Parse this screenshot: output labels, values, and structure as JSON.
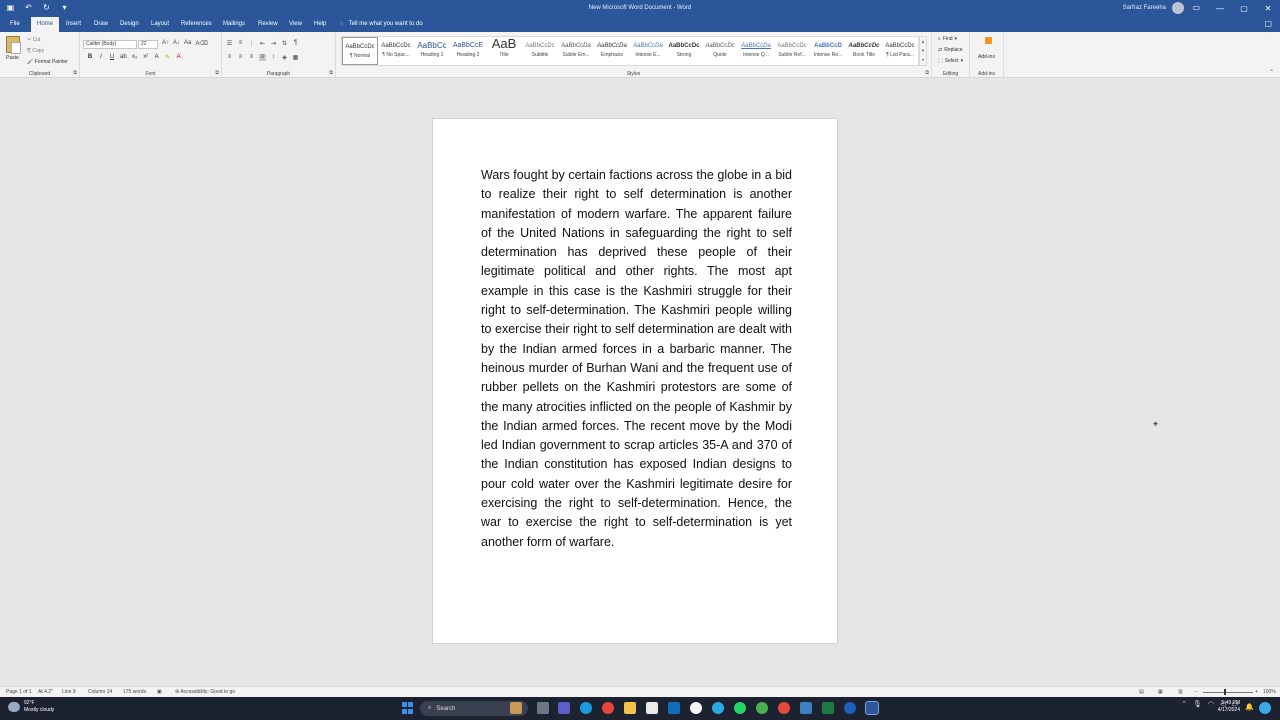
{
  "window": {
    "doc_title": "New Microsoft Word Document  -  Word",
    "user_name": "Sarfraz Fareeha"
  },
  "tabs": [
    "File",
    "Home",
    "Insert",
    "Draw",
    "Design",
    "Layout",
    "References",
    "Mailings",
    "Review",
    "View",
    "Help"
  ],
  "tell_me": "Tell me what you want to do",
  "ribbon": {
    "clipboard": {
      "paste": "Paste",
      "cut": "Cut",
      "copy": "Copy",
      "format_painter": "Format Painter",
      "label": "Clipboard"
    },
    "font": {
      "name": "Calibri (Body)",
      "size": "22",
      "label": "Font"
    },
    "paragraph": {
      "label": "Paragraph"
    },
    "styles": {
      "label": "Styles",
      "items": [
        {
          "sample": "AaBbCcDc",
          "name": "¶ Normal"
        },
        {
          "sample": "AaBbCcDc",
          "name": "¶ No Spac..."
        },
        {
          "sample": "AaBbCc",
          "name": "Heading 1"
        },
        {
          "sample": "AaBbCcE",
          "name": "Heading 2"
        },
        {
          "sample": "AaB",
          "name": "Title"
        },
        {
          "sample": "AaBbCcDc",
          "name": "Subtitle"
        },
        {
          "sample": "AaBbCcDa",
          "name": "Subtle Em..."
        },
        {
          "sample": "AaBbCcDa",
          "name": "Emphasis"
        },
        {
          "sample": "AaBbCcDa",
          "name": "Intense E..."
        },
        {
          "sample": "AaBbCcDc",
          "name": "Strong"
        },
        {
          "sample": "AaBbCcDc",
          "name": "Quote"
        },
        {
          "sample": "AaBbCcDa",
          "name": "Intense Q..."
        },
        {
          "sample": "AaBbCcDc",
          "name": "Subtle Ref..."
        },
        {
          "sample": "AaBbCcD",
          "name": "Intense Re..."
        },
        {
          "sample": "AaBbCcDc",
          "name": "Book Title"
        },
        {
          "sample": "AaBbCcDc",
          "name": "¶ List Para..."
        }
      ]
    },
    "editing": {
      "find": "Find",
      "replace": "Replace",
      "select": "Select",
      "label": "Editing"
    },
    "addins": {
      "button": "Add-ins",
      "label": "Add-ins"
    }
  },
  "document": {
    "body": "Wars fought by certain factions across the globe in a bid to realize their right to self determination is another manifestation of modern warfare. The apparent failure of the United Nations in safeguarding the right to self determination has deprived these people of their legitimate political and other rights. The most apt example in this case is the Kashmiri struggle for their right to self-determination. The Kashmiri people willing to exercise their right to self determination are dealt with by the Indian armed forces in a barbaric manner. The heinous murder of Burhan Wani and the frequent use of rubber pellets on the Kashmiri protestors are some of the many atrocities inflicted on the people of Kashmir by the Indian armed forces. The recent move by the Modi led Indian government to scrap articles 35-A and 370 of the Indian constitution has exposed Indian designs to pour cold water over the Kashmiri legitimate desire for exercising the right to self-determination. Hence, the war to exercise the right to self-determination is yet another form of warfare."
  },
  "status": {
    "page": "Page 1 of 1",
    "at": "At 4.2\"",
    "line": "Line 9",
    "column": "Column 14",
    "words": "175 words",
    "accessibility": "Accessibility: Good to go",
    "zoom": "100%"
  },
  "taskbar": {
    "temp": "92°F",
    "weather": "Mostly cloudy",
    "search_placeholder": "Search",
    "time": "5:49 PM",
    "date": "4/17/2024"
  }
}
